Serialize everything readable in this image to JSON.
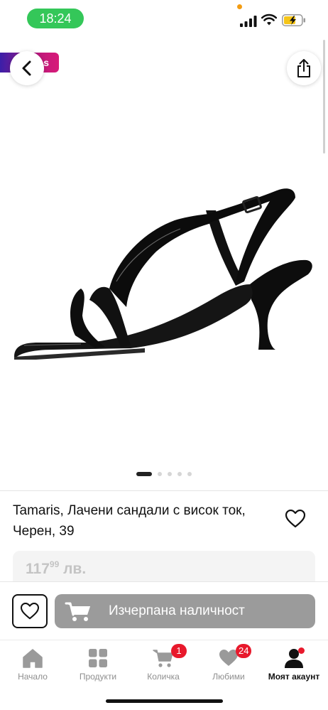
{
  "status_bar": {
    "time": "18:24"
  },
  "image_area": {
    "promo_label": "s",
    "pager": {
      "count": 5,
      "active_index": 0
    }
  },
  "product": {
    "title": "Tamaris, Лачени сандали с висок ток, Черен, 39",
    "price_whole": "117",
    "price_cents": "99",
    "currency": "лв."
  },
  "action_bar": {
    "buy_label": "Изчерпана наличност"
  },
  "tab_bar": {
    "items": [
      {
        "label": "Начало",
        "icon": "home-icon"
      },
      {
        "label": "Продукти",
        "icon": "grid-icon"
      },
      {
        "label": "Количка",
        "icon": "cart-icon",
        "badge": "1"
      },
      {
        "label": "Любими",
        "icon": "heart-icon",
        "badge": "24"
      },
      {
        "label": "Моят акаунт",
        "icon": "person-icon"
      }
    ],
    "active_index": 4
  },
  "colors": {
    "status_green": "#34c759",
    "badge_red": "#e8192c",
    "disabled_button": "#9b9b9b"
  }
}
